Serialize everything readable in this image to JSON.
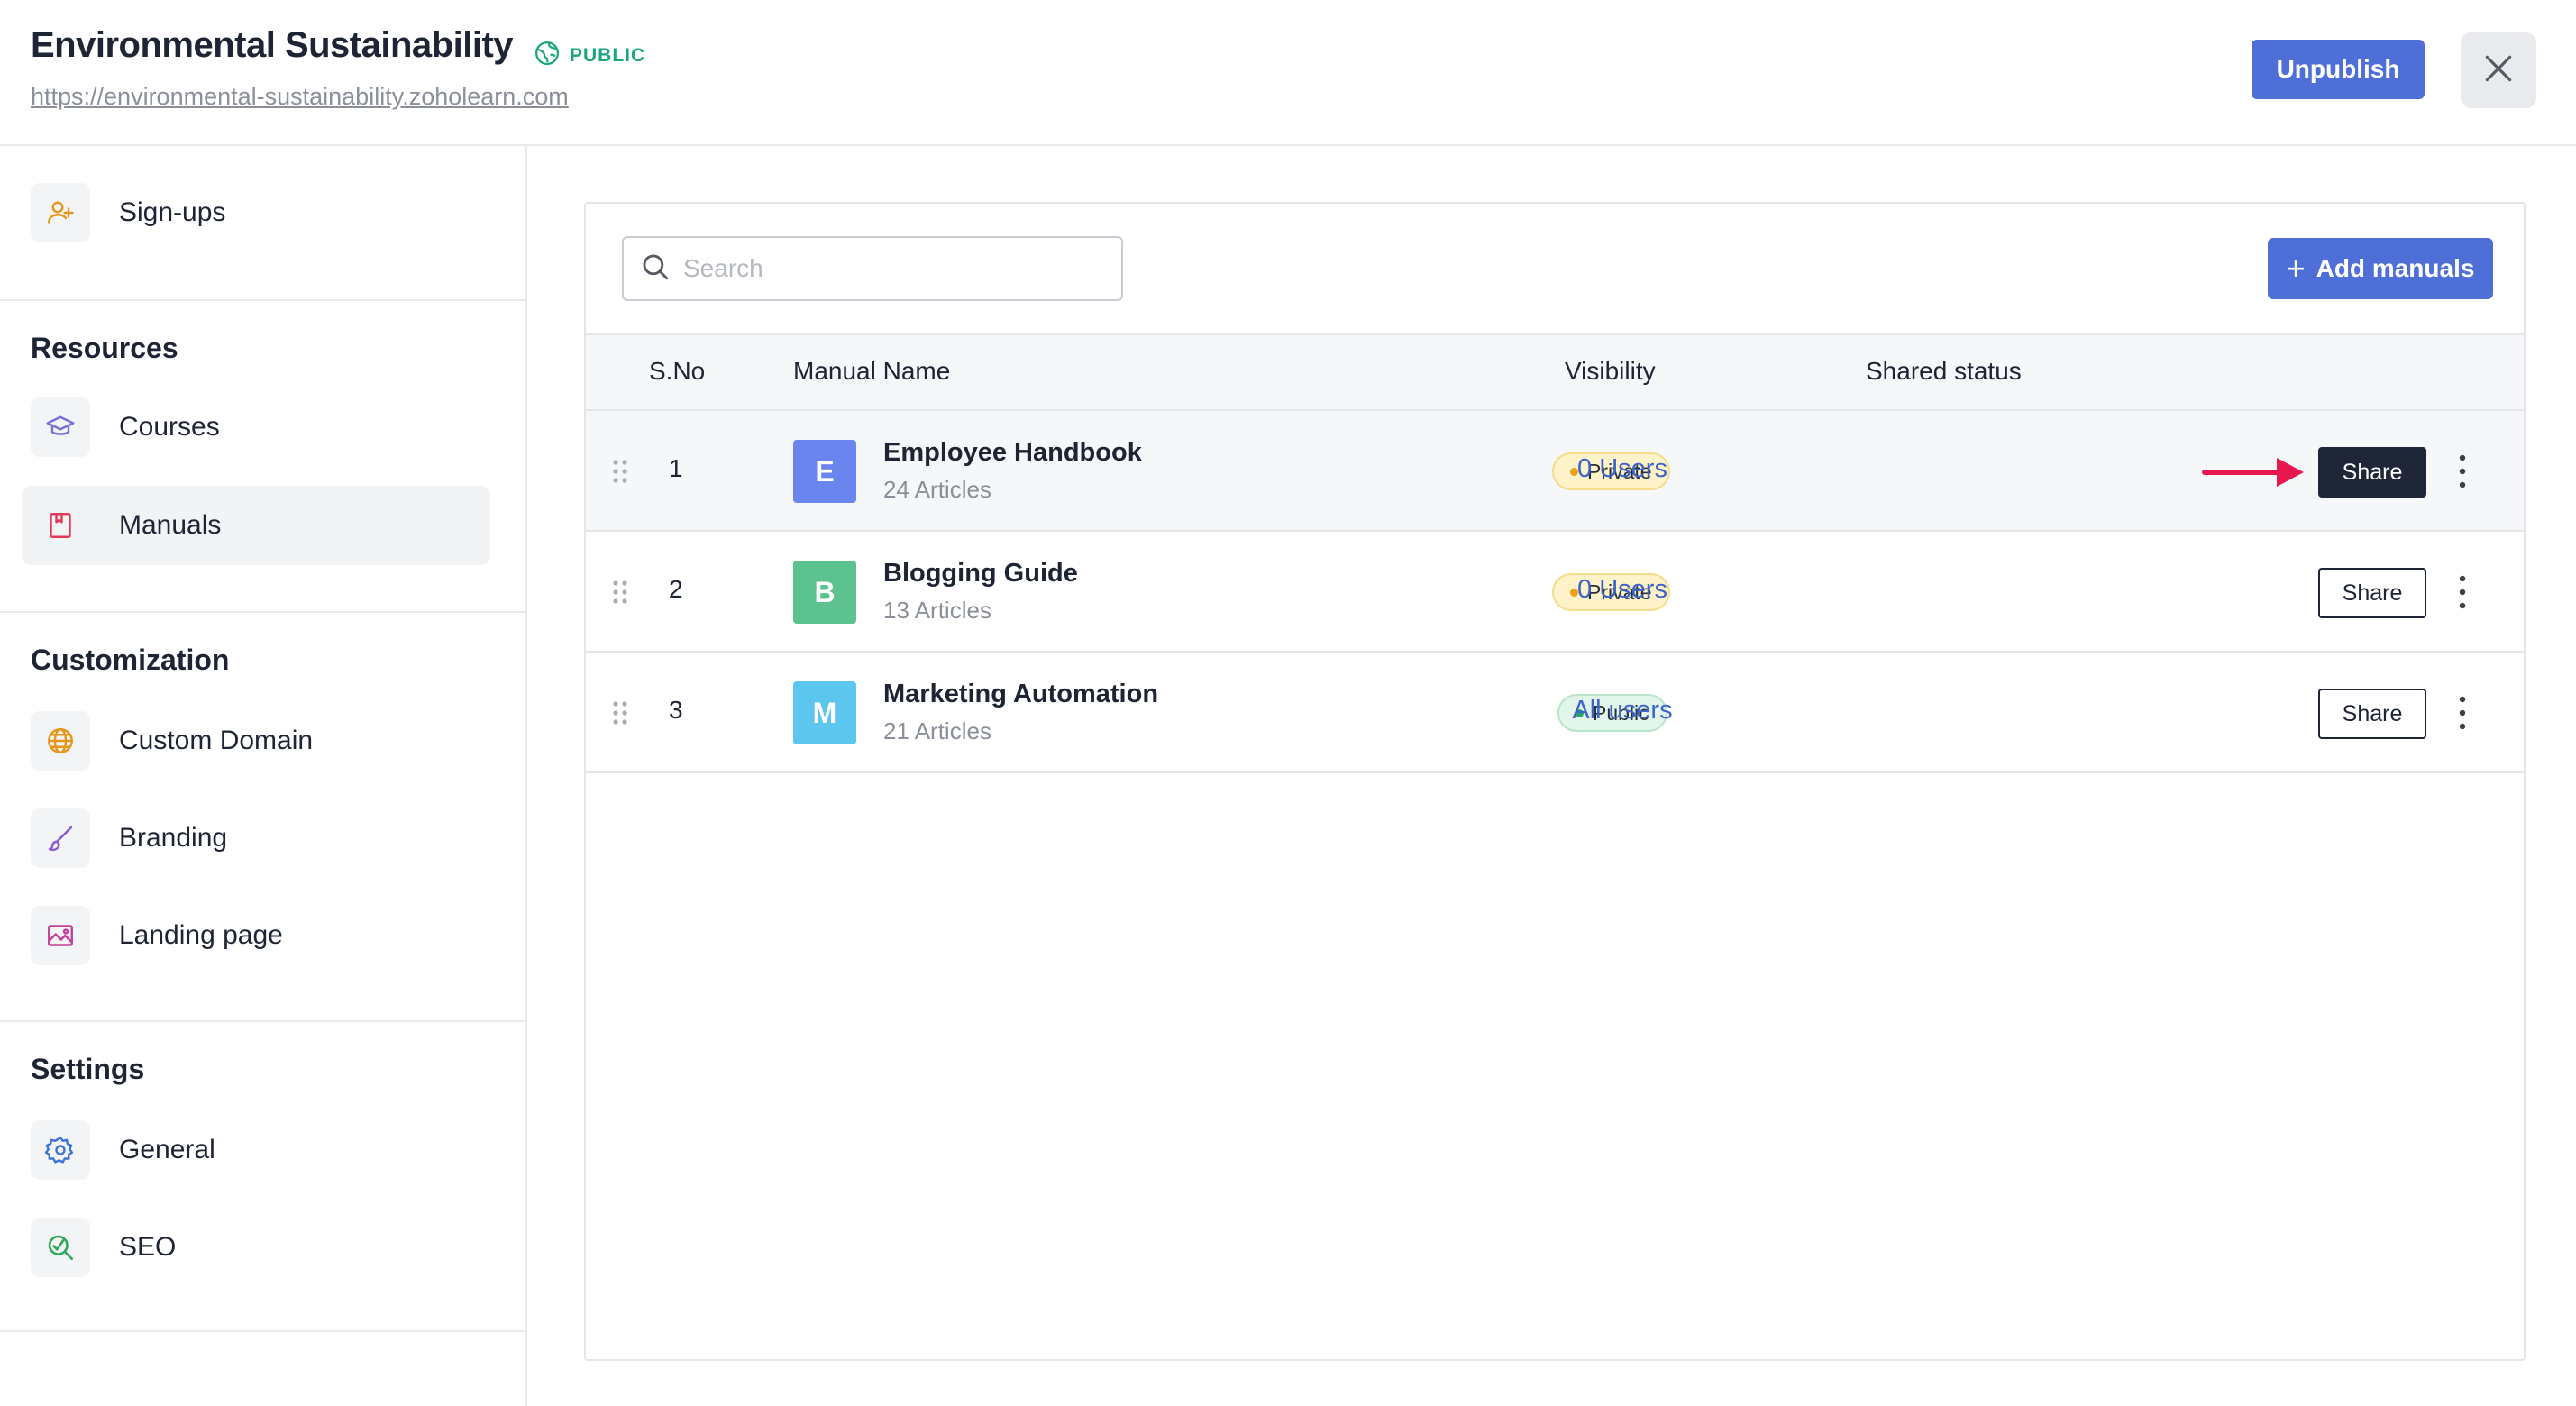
{
  "header": {
    "title": "Environmental Sustainability",
    "badge": "PUBLIC",
    "url": "https://environmental-sustainability.zoholearn.com",
    "unpublish_label": "Unpublish"
  },
  "sidebar": {
    "signups_label": "Sign-ups",
    "sections": {
      "resources": "Resources",
      "customization": "Customization",
      "settings": "Settings"
    },
    "items": {
      "courses": "Courses",
      "manuals": "Manuals",
      "custom_domain": "Custom Domain",
      "branding": "Branding",
      "landing_page": "Landing page",
      "general": "General",
      "seo": "SEO"
    }
  },
  "main": {
    "search_placeholder": "Search",
    "add_label": "Add manuals",
    "columns": {
      "sno": "S.No",
      "name": "Manual Name",
      "visibility": "Visibility",
      "shared": "Shared status"
    },
    "share_label": "Share",
    "rows": [
      {
        "sno": "1",
        "initial": "E",
        "color": "#6a86ee",
        "name": "Employee Handbook",
        "articles": "24 Articles",
        "visibility": "Private",
        "shared": "0 Users"
      },
      {
        "sno": "2",
        "initial": "B",
        "color": "#5cc28f",
        "name": "Blogging Guide",
        "articles": "13 Articles",
        "visibility": "Private",
        "shared": "0 Users"
      },
      {
        "sno": "3",
        "initial": "M",
        "color": "#5cc6ef",
        "name": "Marketing Automation",
        "articles": "21 Articles",
        "visibility": "Public",
        "shared": "All users"
      }
    ]
  },
  "colors": {
    "accent": "#4f6fd8",
    "public_green": "#19a67a",
    "link_blue": "#3d64c8",
    "arrow_red": "#e8174f"
  }
}
